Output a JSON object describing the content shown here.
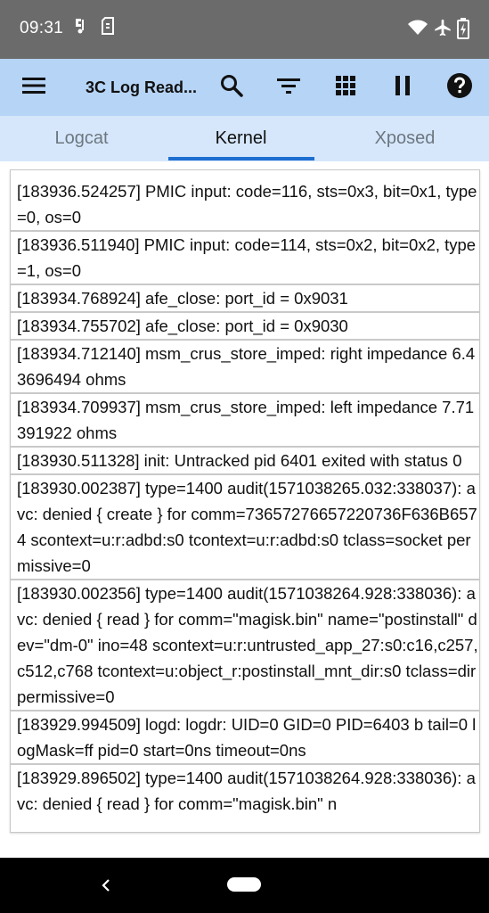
{
  "status_bar": {
    "time": "09:31"
  },
  "app_bar": {
    "title": "3C Log Read..."
  },
  "tabs": [
    {
      "label": "Logcat"
    },
    {
      "label": "Kernel"
    },
    {
      "label": "Xposed"
    }
  ],
  "active_tab": "Kernel",
  "log_entries": [
    "[183936.524257] PMIC input: code=116, sts=0x3, bit=0x1, type=0, os=0",
    "[183936.511940] PMIC input: code=114, sts=0x2, bit=0x2, type=1, os=0",
    "[183934.768924] afe_close: port_id = 0x9031",
    "[183934.755702] afe_close: port_id = 0x9030",
    "[183934.712140] msm_crus_store_imped: right impedance 6.43696494 ohms",
    "[183934.709937] msm_crus_store_imped: left impedance 7.71391922 ohms",
    "[183930.511328] init: Untracked pid 6401 exited with status 0",
    "[183930.002387] type=1400 audit(1571038265.032:338037): avc: denied { create } for comm=73657276657220736F636B6574 scontext=u:r:adbd:s0 tcontext=u:r:adbd:s0 tclass=socket permissive=0",
    "[183930.002356] type=1400 audit(1571038264.928:338036): avc: denied { read } for comm=\"magisk.bin\" name=\"postinstall\" dev=\"dm-0\" ino=48 scontext=u:r:untrusted_app_27:s0:c16,c257,c512,c768 tcontext=u:object_r:postinstall_mnt_dir:s0 tclass=dir permissive=0",
    "[183929.994509] logd: logdr: UID=0 GID=0 PID=6403 b tail=0 logMask=ff pid=0 start=0ns timeout=0ns",
    "[183929.896502] type=1400 audit(1571038264.928:338036): avc: denied { read } for comm=\"magisk.bin\" n"
  ],
  "colors": {
    "status_bar": "#6b6b6b",
    "app_bar": "#b6d4f6",
    "tab_bar": "#d6e7fb",
    "tab_indicator": "#1e6fd0",
    "separator": "#c9c9c9"
  },
  "icons": {
    "menu": "menu-icon",
    "search": "search-icon",
    "filter": "filter-icon",
    "grid": "grid-icon",
    "pause": "pause-icon",
    "help": "help-icon"
  }
}
